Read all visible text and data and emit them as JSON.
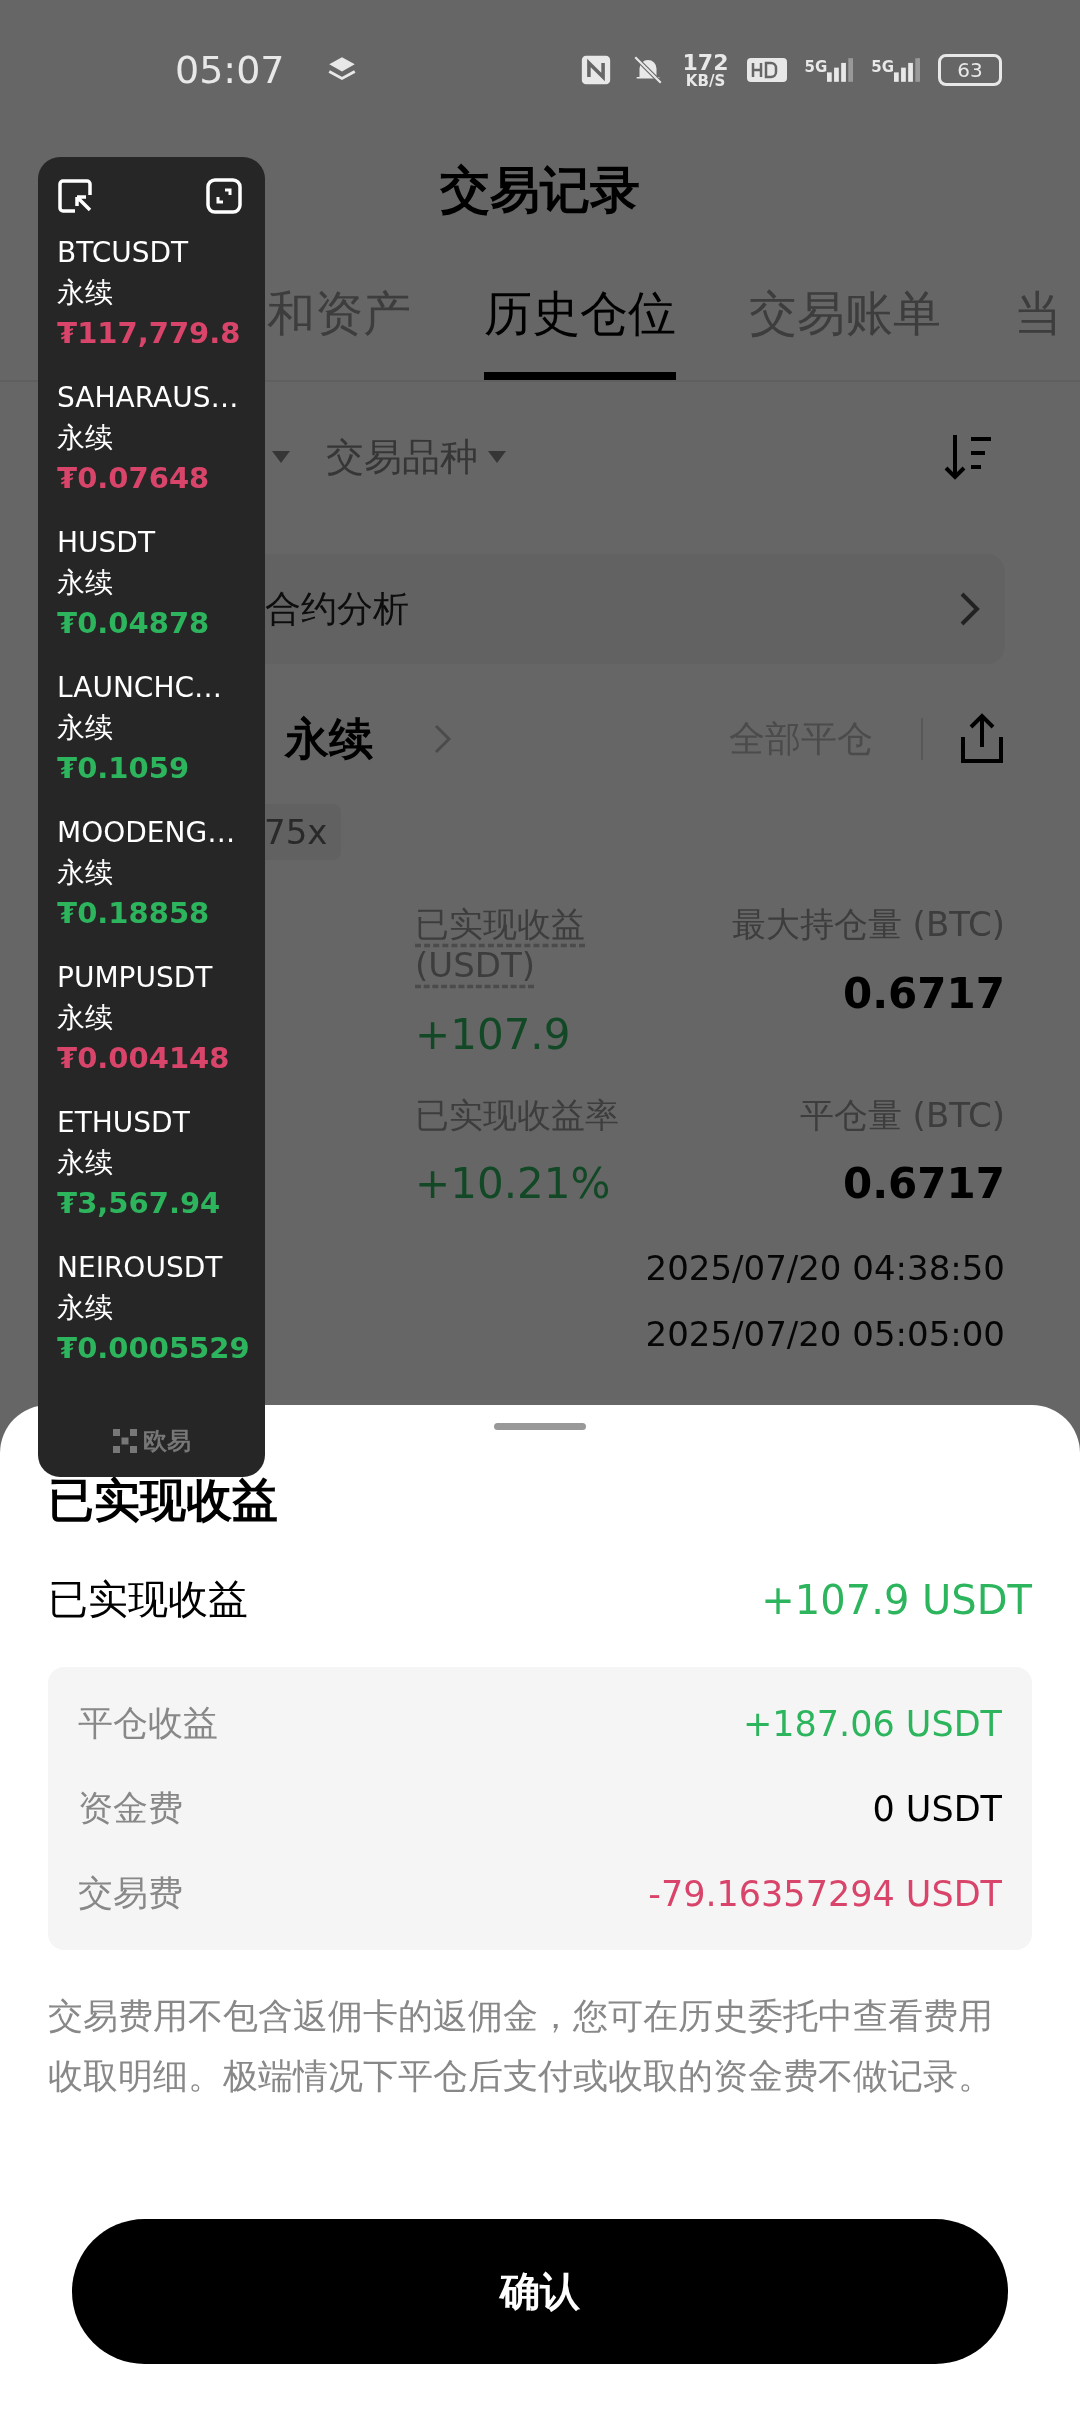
{
  "status_bar": {
    "time": "05:07",
    "speed_value": "172",
    "speed_unit": "KB/S",
    "network_1": "5G",
    "network_2": "5G",
    "battery": "63"
  },
  "header": {
    "title": "交易记录"
  },
  "tabs": [
    {
      "label": "和资产",
      "selected": false
    },
    {
      "label": "历史仓位",
      "selected": true
    },
    {
      "label": "交易账单",
      "selected": false
    },
    {
      "label": "当",
      "selected": false
    }
  ],
  "filters": {
    "instrument": "交易品种"
  },
  "analysis_link": {
    "label": "合约分析"
  },
  "position": {
    "name": "永续",
    "close_all": "全部平仓",
    "leverage": "75x",
    "stats": [
      {
        "label": "已实现收益 (USDT)",
        "value": "+107.9",
        "dashed": true,
        "positive": true
      },
      {
        "label": "最大持仓量 (BTC)",
        "value": "0.6717",
        "dashed": false,
        "positive": false
      },
      {
        "label": "已实现收益率",
        "value": "+10.21%",
        "dashed": false,
        "positive": true
      },
      {
        "label": "平仓量 (BTC)",
        "value": "0.6717",
        "dashed": false,
        "positive": false
      }
    ],
    "times": [
      "2025/07/20 04:38:50",
      "2025/07/20 05:05:00"
    ]
  },
  "ticker_panel": {
    "brand": "欧易",
    "items": [
      {
        "symbol": "BTCUSDT",
        "type": "永续",
        "price": "₮117,779.8",
        "color": "#d9456a"
      },
      {
        "symbol": "SAHARAUS…",
        "type": "永续",
        "price": "₮0.07648",
        "color": "#d9456a"
      },
      {
        "symbol": "HUSDT",
        "type": "永续",
        "price": "₮0.04878",
        "color": "#2db55d"
      },
      {
        "symbol": "LAUNCHC…",
        "type": "永续",
        "price": "₮0.1059",
        "color": "#2db55d"
      },
      {
        "symbol": "MOODENG…",
        "type": "永续",
        "price": "₮0.18858",
        "color": "#2db55d"
      },
      {
        "symbol": "PUMPUSDT",
        "type": "永续",
        "price": "₮0.004148",
        "color": "#d9456a"
      },
      {
        "symbol": "ETHUSDT",
        "type": "永续",
        "price": "₮3,567.94",
        "color": "#2db55d"
      },
      {
        "symbol": "NEIROUSDT",
        "type": "永续",
        "price": "₮0.0005529",
        "color": "#2db55d"
      }
    ]
  },
  "sheet": {
    "title": "已实现收益",
    "total_label": "已实现收益",
    "total_value": "+107.9 USDT",
    "total_positive": true,
    "rows": [
      {
        "label": "平仓收益",
        "value": "+187.06 USDT",
        "color": "#2db55d"
      },
      {
        "label": "资金费",
        "value": "0 USDT",
        "color": "#000000"
      },
      {
        "label": "交易费",
        "value": "-79.16357294 USDT",
        "color": "#d9456a"
      }
    ],
    "note": "交易费用不包含返佣卡的返佣金，您可在历史委托中查看费用收取明细。极端情况下平仓后支付或收取的资金费不做记录。",
    "confirm": "确认"
  }
}
